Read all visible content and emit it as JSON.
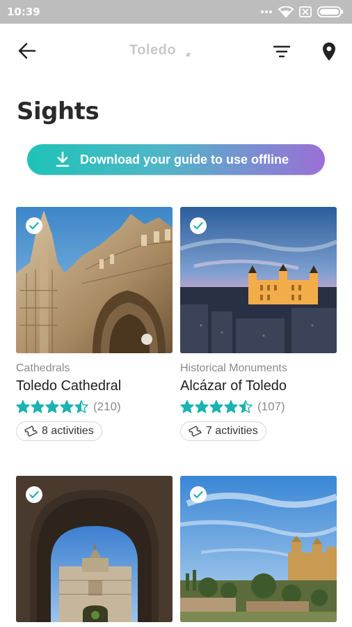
{
  "status_bar": {
    "time": "10:39"
  },
  "header": {
    "title": "Toledo",
    "back_icon": "arrow-left-icon",
    "filter_icon": "filter-icon",
    "map_icon": "map-pin-icon"
  },
  "page": {
    "title": "Sights"
  },
  "download": {
    "label": "Download your guide to use offline",
    "icon": "download-icon",
    "gradient_start": "#1ec3b6",
    "gradient_end": "#9b6fd6"
  },
  "accent_color": "#1ab3b0",
  "cards": [
    {
      "category": "Cathedrals",
      "title": "Toledo Cathedral",
      "rating": 4.5,
      "reviews": "(210)",
      "activities": "8 activities",
      "image": "cathedral-photo",
      "saved": true
    },
    {
      "category": "Historical Monuments",
      "title": "Alcázar of Toledo",
      "rating": 4.5,
      "reviews": "(107)",
      "activities": "7 activities",
      "image": "alcazar-night-photo",
      "saved": true
    },
    {
      "image": "gate-arch-photo",
      "saved": true
    },
    {
      "image": "city-landscape-photo",
      "saved": true
    }
  ]
}
